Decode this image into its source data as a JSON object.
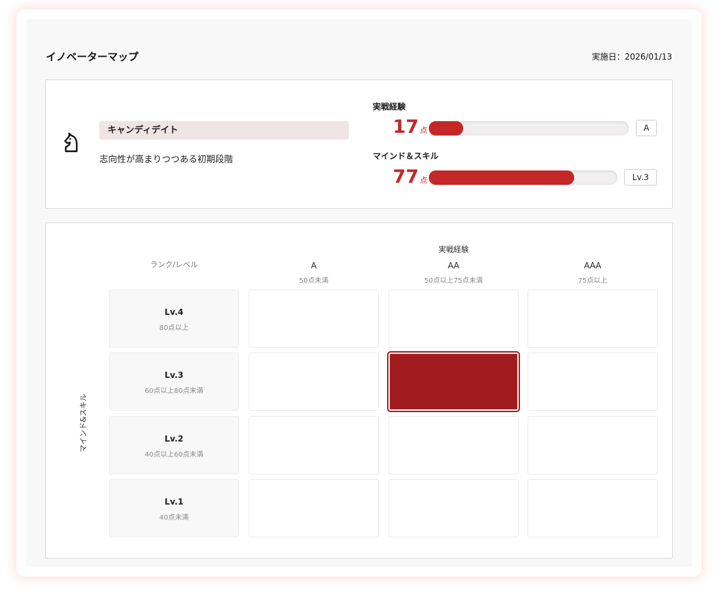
{
  "header": {
    "title": "イノベーターマップ",
    "date_text": "実施日：2026/01/13"
  },
  "summary": {
    "icon": "horse-head-icon",
    "type_label": "キャンディデイト",
    "type_description": "志向性が高まりつつある初期段階",
    "metrics": [
      {
        "label": "実戦経験",
        "score": "17",
        "unit": "点",
        "rank": "A",
        "fill_percent": 17
      },
      {
        "label": "マインド＆スキル",
        "score": "77",
        "unit": "点",
        "rank": "Lv.3",
        "fill_percent": 77
      }
    ]
  },
  "matrix": {
    "x_axis_title": "実戦経験",
    "y_axis_title": "マインド&スキル",
    "corner_label": "ランク/レベル",
    "columns": [
      {
        "label": "A",
        "sub": "50点未満"
      },
      {
        "label": "AA",
        "sub": "50点以上75点未満"
      },
      {
        "label": "AAA",
        "sub": "75点以上"
      }
    ],
    "rows": [
      {
        "label": "Lv.4",
        "sub": "80点以上"
      },
      {
        "label": "Lv.3",
        "sub": "60点以上80点未満"
      },
      {
        "label": "Lv.2",
        "sub": "40点以上60点未満"
      },
      {
        "label": "Lv.1",
        "sub": "40点未満"
      }
    ],
    "highlight": {
      "row": "Lv.3",
      "column": "AA"
    }
  },
  "colors": {
    "accent": "#c42727",
    "highlight_cell": "#a11c1f",
    "badge_bg": "#ede4e3"
  }
}
